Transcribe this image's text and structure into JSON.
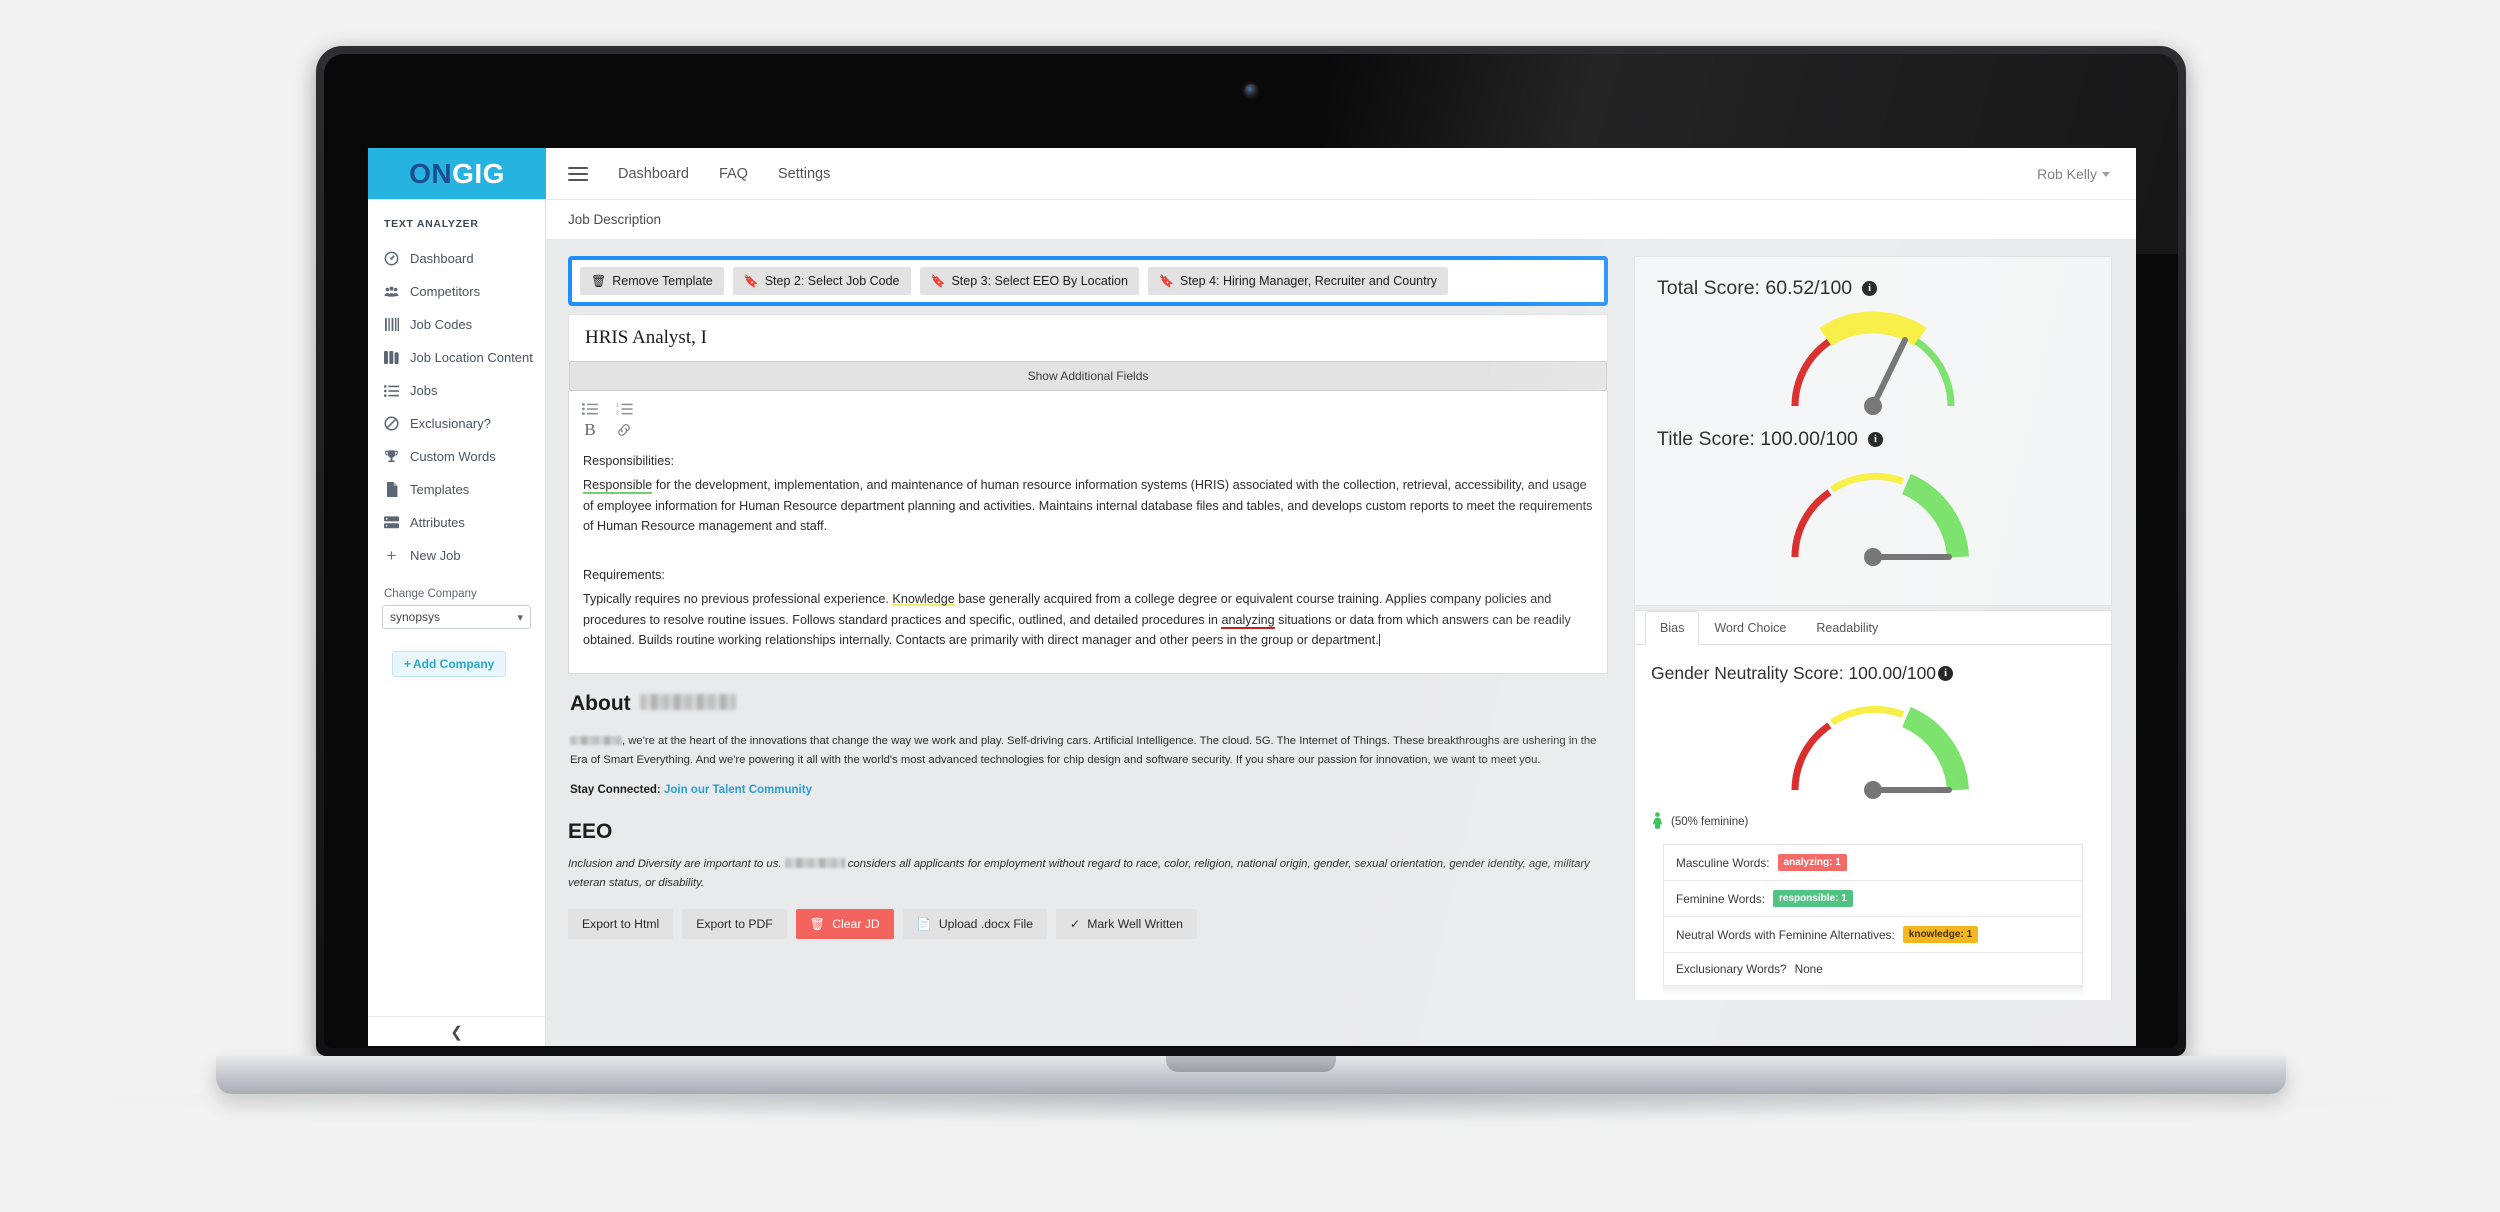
{
  "brand": {
    "on": "ON",
    "gig": "GIG"
  },
  "topnav": {
    "menu_icon": "hamburger-icon",
    "links": [
      "Dashboard",
      "FAQ",
      "Settings"
    ],
    "user": "Rob Kelly"
  },
  "sidebar": {
    "title": "TEXT ANALYZER",
    "items": [
      {
        "label": "Dashboard",
        "icon": "dashboard-icon"
      },
      {
        "label": "Competitors",
        "icon": "competitors-icon"
      },
      {
        "label": "Job Codes",
        "icon": "barcode-icon"
      },
      {
        "label": "Job Location Content",
        "icon": "book-icon"
      },
      {
        "label": "Jobs",
        "icon": "list-icon"
      },
      {
        "label": "Exclusionary?",
        "icon": "ban-icon"
      },
      {
        "label": "Custom Words",
        "icon": "trophy-icon"
      },
      {
        "label": "Templates",
        "icon": "file-icon"
      },
      {
        "label": "Attributes",
        "icon": "server-icon"
      },
      {
        "label": "New Job",
        "icon": "plus-icon"
      }
    ],
    "change_company_label": "Change Company",
    "company_value": "synopsys",
    "add_company_label": "Add Company",
    "collapse_icon": "chevron-left-icon"
  },
  "breadcrumb": "Job Description",
  "steps": [
    {
      "label": "Remove Template",
      "icon": "trash-icon"
    },
    {
      "label": "Step 2: Select Job Code",
      "icon": "bookmark-icon"
    },
    {
      "label": "Step 3: Select EEO By Location",
      "icon": "bookmark-icon"
    },
    {
      "label": "Step 4: Hiring Manager, Recruiter and Country",
      "icon": "bookmark-icon"
    }
  ],
  "editor": {
    "job_title": "HRIS Analyst, I",
    "additional_fields_label": "Show Additional Fields",
    "toolbar_icons": [
      "bullet-list-icon",
      "numbered-list-icon",
      "bold-icon",
      "link-icon"
    ],
    "responsibilities_heading": "Responsibilities:",
    "resp_word_green": "Responsible",
    "resp_text_1": " for the development, implementation, and maintenance of human resource information systems (HRIS) associated with the collection, retrieval, accessibility, and usage of employee information for Human Resource department planning and activities.  Maintains internal database files and tables, and develops custom reports to meet the requirements of Human Resource management and staff.",
    "requirements_heading": "Requirements:",
    "req_text_1": "Typically requires no previous professional experience.  ",
    "req_word_yellow": "Knowledge",
    "req_text_2": " base generally acquired from a college degree or equivalent course training.  Applies company policies and procedures to resolve routine issues.  Follows standard practices and specific, outlined, and detailed procedures in ",
    "req_word_red": "analyzing",
    "req_text_3": " situations or data from which answers can be readily obtained.  Builds routine working relationships internally. Contacts are primarily with direct manager and other peers in the group or department."
  },
  "about": {
    "heading": "About",
    "company_redacted": true,
    "paragraph": ", we're at the heart of the innovations that change the way we work and play. Self-driving cars. Artificial Intelligence. The cloud. 5G. The Internet of Things. These breakthroughs are ushering in the Era of Smart Everything. And we're powering it all with the world's most advanced technologies for chip design and software security. If you share our passion for innovation, we want to meet you.",
    "stay_label": "Stay Connected:",
    "stay_link": "Join our Talent Community"
  },
  "eeo": {
    "heading": "EEO",
    "text_before": "Inclusion and Diversity are important to us. ",
    "text_after": " considers all applicants for employment without regard to race, color, religion, national origin, gender, sexual orientation, gender identity, age, military veteran status, or disability."
  },
  "bottom_buttons": [
    {
      "label": "Export to Html",
      "icon": "none",
      "style": "default"
    },
    {
      "label": "Export to PDF",
      "icon": "none",
      "style": "default"
    },
    {
      "label": "Clear JD",
      "icon": "trash-icon",
      "style": "danger"
    },
    {
      "label": "Upload .docx File",
      "icon": "file-upload-icon",
      "style": "default"
    },
    {
      "label": "Mark Well Written",
      "icon": "check-icon",
      "style": "default"
    }
  ],
  "scores": {
    "total_label": "Total Score: 60.52/100",
    "title_label": "Title Score: 100.00/100",
    "gender_label": "Gender Neutrality Score: 100.00/100",
    "feminine_note": "(50% feminine)",
    "tabs": [
      "Bias",
      "Word Choice",
      "Readability"
    ],
    "active_tab": "Bias"
  },
  "word_table": [
    {
      "label": "Masculine Words:",
      "badge": "analyzing: 1",
      "badge_color": "red"
    },
    {
      "label": "Feminine Words:",
      "badge": "responsible: 1",
      "badge_color": "green"
    },
    {
      "label": "Neutral Words with Feminine Alternatives:",
      "badge": "knowledge: 1",
      "badge_color": "amber"
    },
    {
      "label": "Exclusionary Words?",
      "badge": "None",
      "badge_color": "none"
    }
  ],
  "chart_data": [
    {
      "type": "gauge",
      "title": "Total Score",
      "value": 60.52,
      "ylim": [
        0,
        100
      ],
      "needle_angle_deg": 19,
      "bands": [
        {
          "name": "low",
          "range": [
            0,
            33
          ],
          "color": "#d6201f"
        },
        {
          "name": "medium",
          "range": [
            33,
            66
          ],
          "color": "#f7ee3c"
        },
        {
          "name": "high",
          "range": [
            66,
            100
          ],
          "color": "#76e066"
        }
      ],
      "highlight_band": "medium"
    },
    {
      "type": "gauge",
      "title": "Title Score",
      "value": 100.0,
      "ylim": [
        0,
        100
      ],
      "needle_angle_deg": 90,
      "bands": [
        {
          "name": "low",
          "range": [
            0,
            33
          ],
          "color": "#d6201f"
        },
        {
          "name": "medium",
          "range": [
            33,
            66
          ],
          "color": "#f7ee3c"
        },
        {
          "name": "high",
          "range": [
            66,
            100
          ],
          "color": "#76e066"
        }
      ],
      "highlight_band": "high"
    },
    {
      "type": "gauge",
      "title": "Gender Neutrality Score",
      "value": 100.0,
      "ylim": [
        0,
        100
      ],
      "needle_angle_deg": 90,
      "bands": [
        {
          "name": "low",
          "range": [
            0,
            33
          ],
          "color": "#d6201f"
        },
        {
          "name": "medium",
          "range": [
            33,
            66
          ],
          "color": "#f7ee3c"
        },
        {
          "name": "high",
          "range": [
            66,
            100
          ],
          "color": "#76e066"
        }
      ],
      "highlight_band": "high"
    }
  ]
}
